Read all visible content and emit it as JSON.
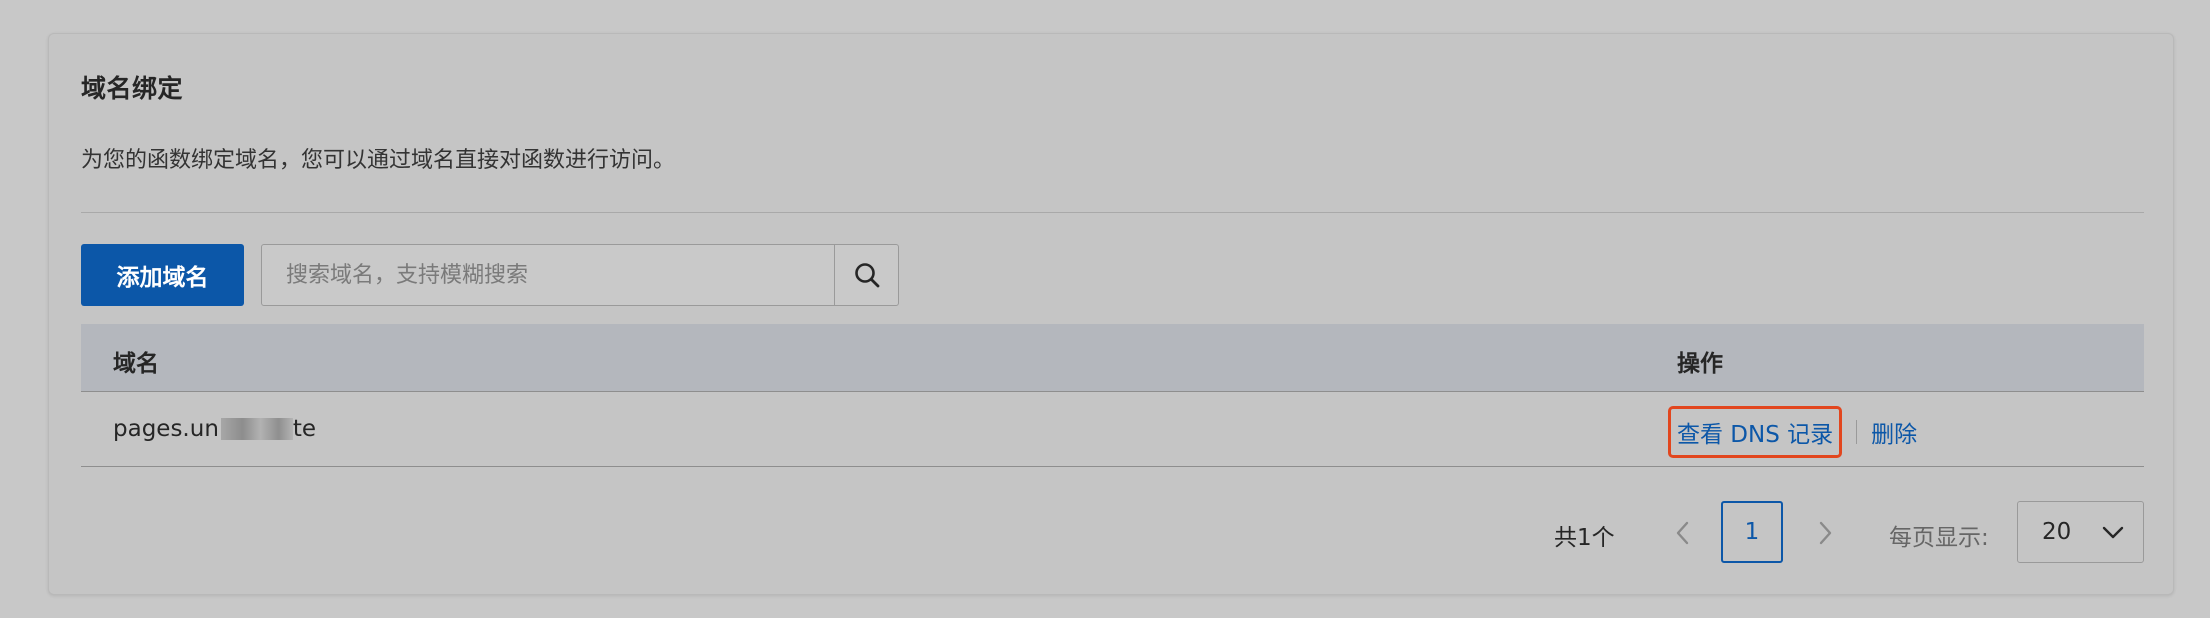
{
  "section": {
    "title": "域名绑定",
    "description": "为您的函数绑定域名，您可以通过域名直接对函数进行访问。"
  },
  "toolbar": {
    "add_label": "添加域名",
    "search_placeholder": "搜索域名，支持模糊搜索",
    "search_icon": "search-icon"
  },
  "table": {
    "columns": [
      "域名",
      "操作"
    ],
    "rows": [
      {
        "domain_prefix": "pages.un",
        "domain_suffix": "te",
        "actions": [
          "查看 DNS 记录",
          "删除"
        ]
      }
    ]
  },
  "pagination": {
    "total_label": "共1个",
    "current_page": "1",
    "per_page_label": "每页显示:",
    "per_page_value": "20"
  },
  "colors": {
    "primary": "#0c57a8",
    "highlight": "#e2461e",
    "background": "#c8c8c8"
  }
}
